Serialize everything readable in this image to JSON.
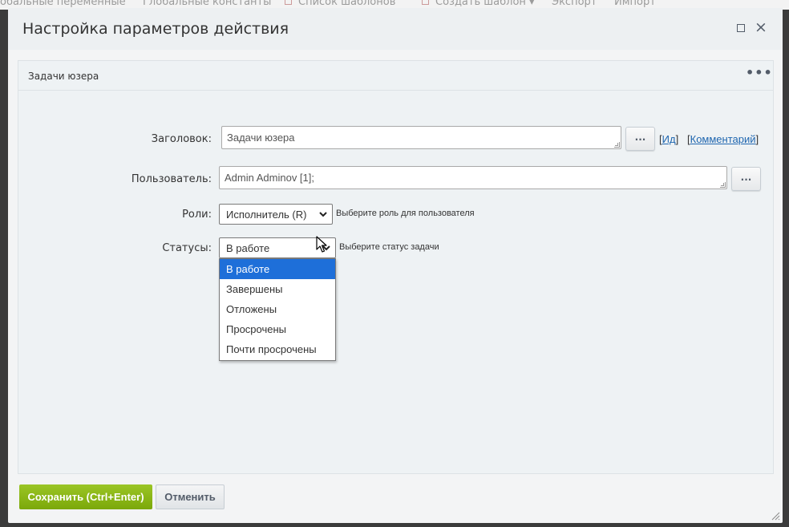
{
  "background_app": {
    "items": [
      "обальные переменные",
      "Глобальные константы",
      "Список шаблонов",
      "Создать шаблон ▾",
      "Экспорт",
      "Импорт"
    ]
  },
  "dialog": {
    "title": "Настройка параметров действия",
    "maximize_icon": "maximize-icon",
    "close_icon": "×"
  },
  "panel": {
    "title": "Задачи юзера",
    "more_icon": "•••"
  },
  "form": {
    "title_label": "Заголовок:",
    "title_value": "Задачи юзера",
    "title_dots": "...",
    "id_link": "Ид",
    "comment_link": "Комментарий",
    "user_label": "Пользователь:",
    "user_value": "Admin Adminov [1];",
    "user_dots": "...",
    "role_label": "Роли:",
    "role_value": "Исполнитель (R)",
    "role_hint": "Выберите роль для пользователя",
    "status_label": "Статусы:",
    "status_value": "В работе",
    "status_hint": "Выберите статус задачи",
    "status_options": [
      "В работе",
      "Завершены",
      "Отложены",
      "Просрочены",
      "Почти просрочены"
    ],
    "status_selected_index": 0
  },
  "footer": {
    "save_label": "Сохранить (Ctrl+Enter)",
    "cancel_label": "Отменить"
  },
  "colors": {
    "save_button": "#8bb817",
    "option_highlight": "#1e6fd9",
    "link": "#2067b0"
  }
}
